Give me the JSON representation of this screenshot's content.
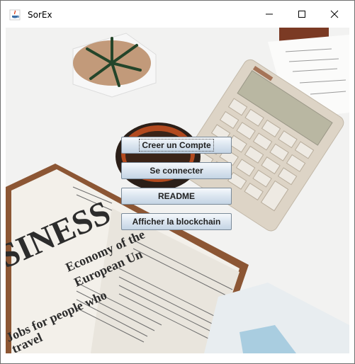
{
  "window": {
    "title": "SorEx",
    "icon": "java-cup-icon",
    "controls": [
      "minimize-icon",
      "maximize-icon",
      "close-icon"
    ]
  },
  "menu": {
    "buttons": [
      {
        "label": "Creer un Compte",
        "focused": true
      },
      {
        "label": "Se connecter"
      },
      {
        "label": "README"
      },
      {
        "label": "Afficher la blockchain"
      }
    ]
  },
  "background": {
    "description_icon": "desk-newspaper-calculator-photo-icon",
    "newspaper": {
      "masthead": "SINESS",
      "headline_1": "Economy of the",
      "headline_2": "European Un",
      "headline_3": "Jobs for people who",
      "headline_4": "travel"
    }
  }
}
